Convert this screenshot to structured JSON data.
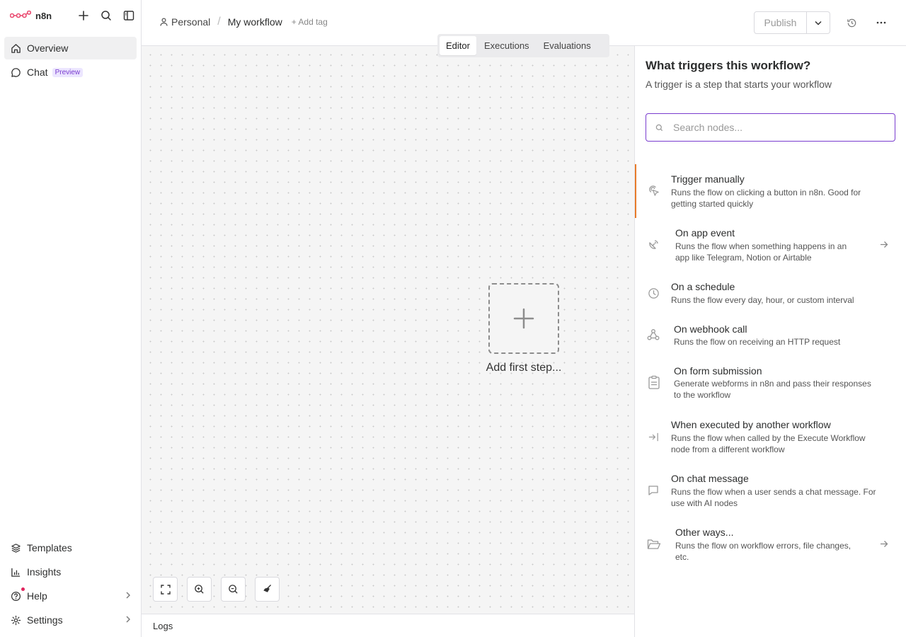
{
  "app": {
    "name": "n8n"
  },
  "sidebar": {
    "items": [
      {
        "label": "Overview"
      },
      {
        "label": "Chat",
        "badge": "Preview"
      }
    ],
    "bottom": [
      {
        "label": "Templates"
      },
      {
        "label": "Insights"
      },
      {
        "label": "Help"
      },
      {
        "label": "Settings"
      }
    ]
  },
  "header": {
    "project": "Personal",
    "separator": "/",
    "workflow_name": "My workflow",
    "add_tag": "+ Add tag",
    "publish": "Publish"
  },
  "tabs": [
    {
      "label": "Editor",
      "active": true
    },
    {
      "label": "Executions"
    },
    {
      "label": "Evaluations"
    }
  ],
  "canvas": {
    "add_first_step": "Add first step...",
    "logs_label": "Logs"
  },
  "panel": {
    "title": "What triggers this workflow?",
    "subtitle": "A trigger is a step that starts your workflow",
    "search_placeholder": "Search nodes...",
    "triggers": [
      {
        "title": "Trigger manually",
        "desc_lines": [
          "Runs the flow on clicking a button in n8n. Good for",
          "getting started quickly"
        ],
        "icon": "cursor-click-icon"
      },
      {
        "title": "On app event",
        "desc_lines": [
          "Runs the flow when something happens in an",
          "app like Telegram, Notion or Airtable"
        ],
        "icon": "satellite-dish-icon",
        "has_arrow": true
      },
      {
        "title": "On a schedule",
        "desc_lines": [
          "Runs the flow every day, hour, or custom interval"
        ],
        "icon": "clock-icon"
      },
      {
        "title": "On webhook call",
        "desc_lines": [
          "Runs the flow on receiving an HTTP request"
        ],
        "icon": "webhook-icon"
      },
      {
        "title": "On form submission",
        "desc_lines": [
          "Generate webforms in n8n and pass their responses",
          "to the workflow"
        ],
        "icon": "clipboard-icon"
      },
      {
        "title": "When executed by another workflow",
        "desc_lines": [
          "Runs the flow when called by the Execute Workflow",
          "node from a different workflow"
        ],
        "icon": "sign-in-icon"
      },
      {
        "title": "On chat message",
        "desc_lines": [
          "Runs the flow when a user sends a chat message. For",
          "use with AI nodes"
        ],
        "icon": "chat-bubble-icon"
      },
      {
        "title": "Other ways...",
        "desc_lines": [
          "Runs the flow on workflow errors, file changes,",
          "etc."
        ],
        "icon": "folder-open-icon",
        "has_arrow": true
      }
    ]
  },
  "colors": {
    "brand": "#ea4b71",
    "accent": "#7a3ccf",
    "selected_bar": "#e87b2a"
  }
}
